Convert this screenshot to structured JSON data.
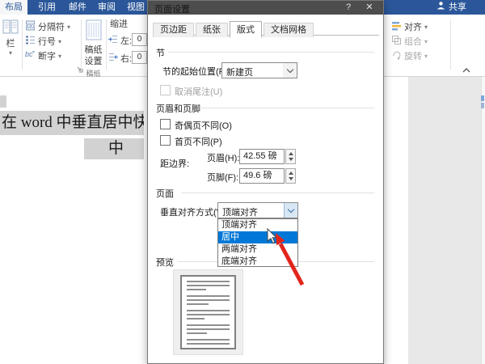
{
  "ribbon": {
    "tabs": [
      "布局",
      "引用",
      "邮件",
      "审阅",
      "视图"
    ],
    "share_label": "共享",
    "page_setup_group": {
      "columns": "栏",
      "breaks": "分隔符",
      "line_numbers": "行号",
      "hyphenation": "断字"
    },
    "paper_group": {
      "button_line1": "稿纸",
      "button_line2": "设置",
      "group_label": "稿纸"
    },
    "indent_group": {
      "title": "缩进",
      "left_label": "左:",
      "left_value": "0",
      "right_label": "右:",
      "right_value": "0"
    },
    "arrange_group": {
      "align": "对齐",
      "combine": "组合",
      "rotate": "旋转"
    }
  },
  "document": {
    "line1": "在 word 中垂直居中快",
    "line2": "中"
  },
  "dialog": {
    "title": "页面设置",
    "help_label": "?",
    "close_label": "✕",
    "tabs": [
      "页边距",
      "纸张",
      "版式",
      "文档网格"
    ],
    "active_tab": "版式",
    "section_group": {
      "label": "节",
      "start_label": "节的起始位置(R):",
      "start_value": "新建页",
      "suppress_endnotes_label": "取消尾注(U)"
    },
    "header_footer_group": {
      "label": "页眉和页脚",
      "odd_even_label": "奇偶页不同(O)",
      "first_page_label": "首页不同(P)",
      "from_edge_label": "距边界:",
      "header_label": "页眉(H):",
      "header_value": "42.55 磅",
      "footer_label": "页脚(F):",
      "footer_value": "49.6 磅"
    },
    "page_group": {
      "label": "页面",
      "valign_label": "垂直对齐方式(V):",
      "valign_value": "顶端对齐",
      "dropdown_options": [
        "顶端对齐",
        "居中",
        "两端对齐",
        "底端对齐"
      ],
      "highlighted_option": "居中"
    },
    "preview_group": {
      "label": "预览"
    }
  },
  "colors": {
    "ribbon_blue": "#2b579a",
    "selection_blue": "#0078d7",
    "arrow_red": "#e2251b",
    "dialog_titlebar": "#4d4d4d",
    "text_highlight": "#d2d2d2"
  }
}
